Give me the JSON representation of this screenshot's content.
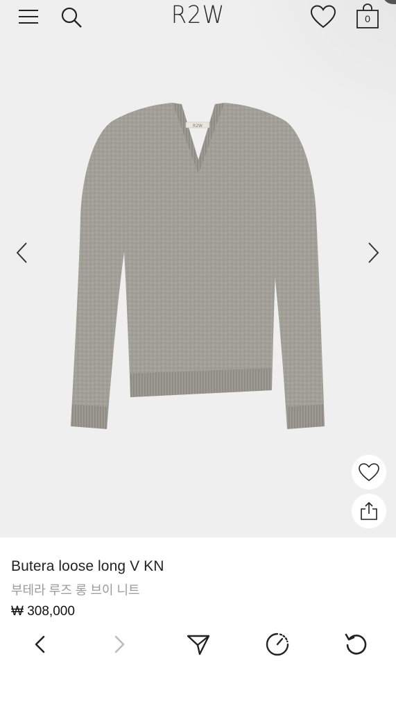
{
  "header": {
    "brand": "R2W",
    "cart_count": "0",
    "icons": [
      "menu-icon",
      "search-icon",
      "heart-icon",
      "shopping-bag-icon"
    ]
  },
  "gallery": {
    "image_label": "R2W",
    "prev_icon": "chevron-left-icon",
    "next_icon": "chevron-right-icon",
    "colors": {
      "background": "#efefef",
      "sweater": "#a29f98"
    }
  },
  "actions": {
    "wishlist_icon": "heart-icon",
    "share_icon": "share-icon"
  },
  "product": {
    "name": "Butera loose long V KN",
    "name_ko": "부테라 루즈 롱 브이 니트",
    "price": "₩ 308,000"
  },
  "toolbar": {
    "icons": [
      "back-icon",
      "forward-icon",
      "send-icon",
      "speed-icon",
      "reload-icon"
    ]
  }
}
